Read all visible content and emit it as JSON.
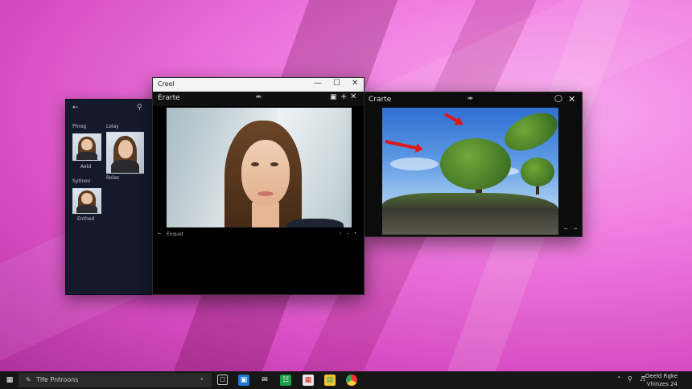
{
  "window_photos": {
    "back_icon": "back-arrow-icon",
    "search_icon": "search-icon",
    "sections": [
      {
        "label": "Phrog"
      },
      {
        "label": "Lolay"
      },
      {
        "label": "Sytinov"
      }
    ],
    "thumbs": [
      {
        "caption": "Aeld"
      },
      {
        "caption": "Roles"
      },
      {
        "caption": "Enthed"
      }
    ]
  },
  "window_portrait": {
    "title": "Creel",
    "toolbar_label": "Erarte",
    "status_label": "Exquet"
  },
  "window_landscape": {
    "title": "Crarte"
  },
  "taskbar": {
    "search_text": "Tlfe Pntroons",
    "clock_line1": "Oeeld Rgke",
    "clock_line2": "Vhinzes 24"
  },
  "colors": {
    "desktop_pink": "#f07ce0",
    "taskbar_bg": "#161616",
    "arrow_red": "#e01818"
  }
}
